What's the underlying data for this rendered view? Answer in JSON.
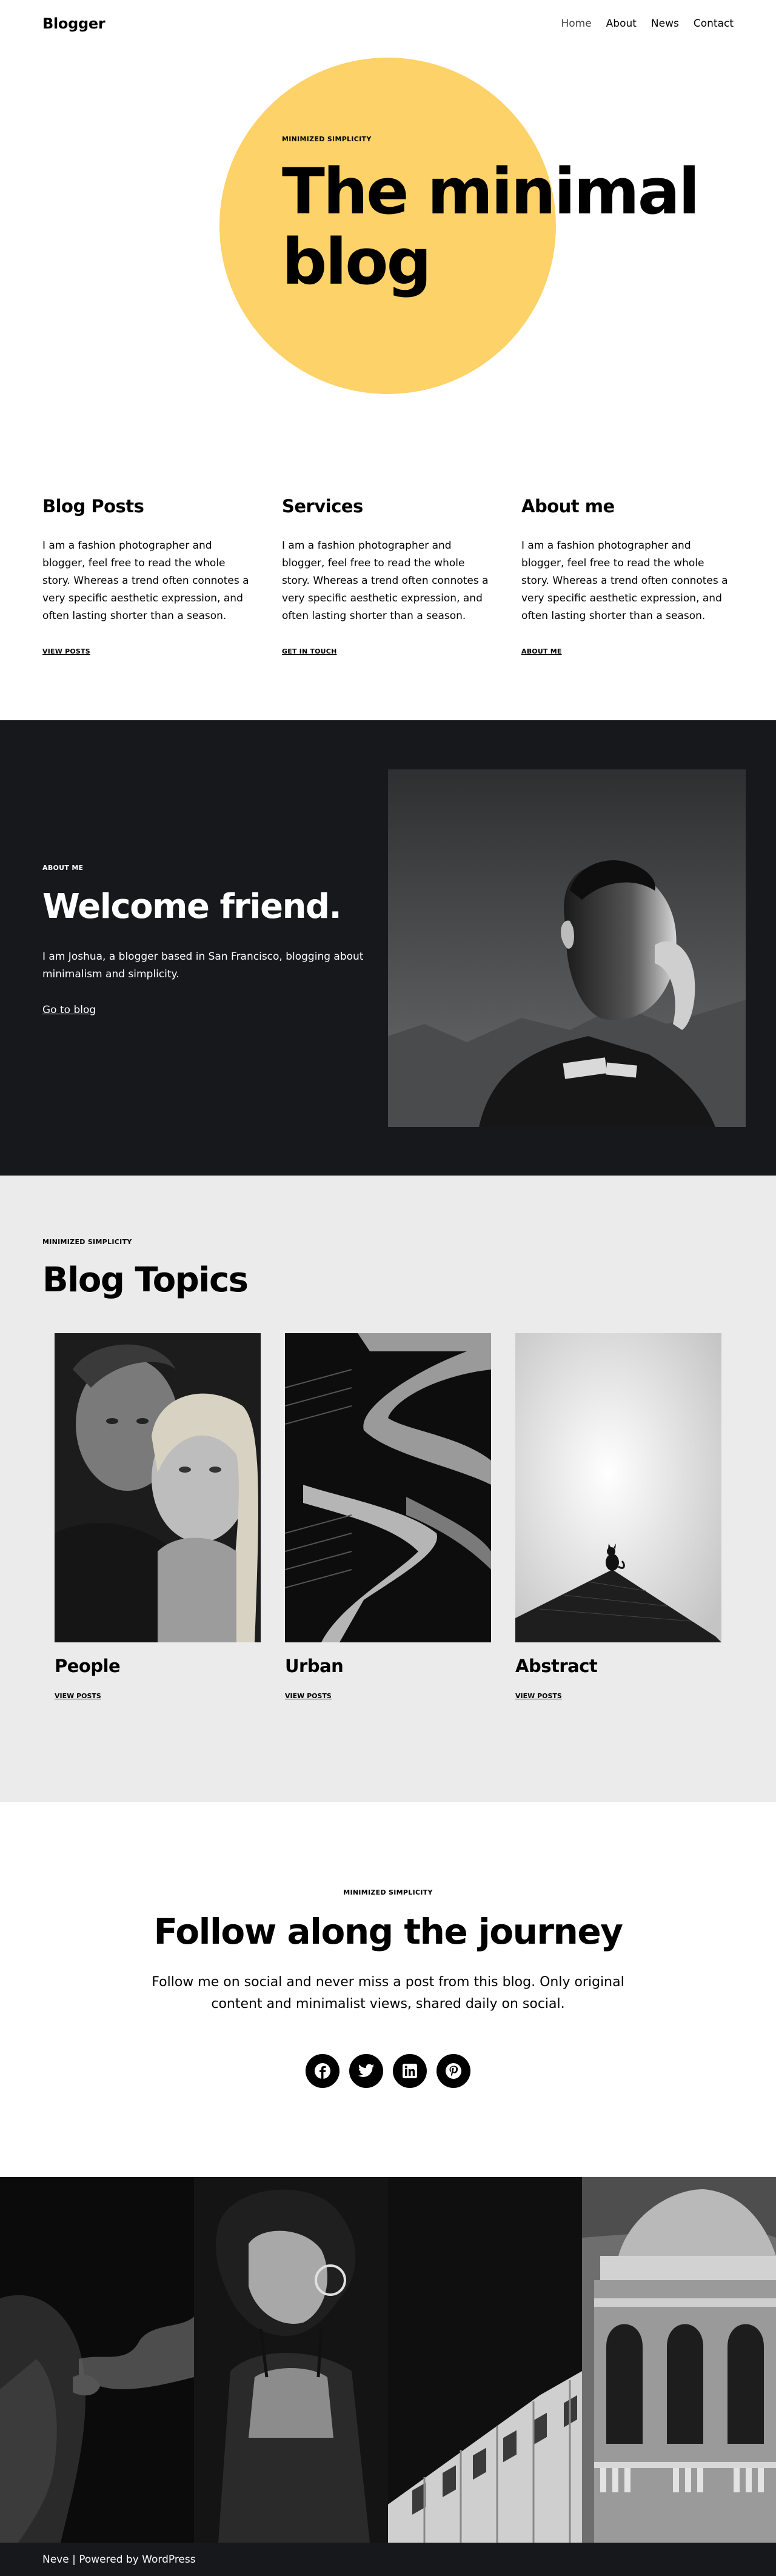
{
  "header": {
    "logo": "Blogger",
    "nav": [
      "Home",
      "About",
      "News",
      "Contact"
    ]
  },
  "hero": {
    "kicker": "MINIMIZED SIMPLICITY",
    "title_line1": "The minimal",
    "title_line2": "blog",
    "accent_color": "#fdd268"
  },
  "features": [
    {
      "title": "Blog Posts",
      "text": "I am a fashion photographer and blogger, feel free to read the whole story. Whereas a trend often connotes a very specific aesthetic expression, and often lasting shorter than a season.",
      "link": "VIEW POSTS"
    },
    {
      "title": "Services",
      "text": "I am a fashion photographer and blogger, feel free to read the whole story. Whereas a trend often connotes a very specific aesthetic expression, and often lasting shorter than a season.",
      "link": "GET IN TOUCH"
    },
    {
      "title": "About me",
      "text": "I am a fashion photographer and blogger, feel free to read the whole story. Whereas a trend often connotes a very specific aesthetic expression, and often lasting shorter than a season.",
      "link": "ABOUT ME"
    }
  ],
  "welcome": {
    "kicker": "ABOUT ME",
    "title": "Welcome friend.",
    "text": "I am Joshua, a blogger based in San Francisco, blogging about minimalism and simplicity.",
    "link": "Go to blog",
    "background": "#16181c"
  },
  "topics": {
    "kicker": "MINIMIZED SIMPLICITY",
    "title": "Blog Topics",
    "items": [
      {
        "title": "People",
        "link": "VIEW POSTS"
      },
      {
        "title": "Urban",
        "link": "VIEW POSTS"
      },
      {
        "title": "Abstract",
        "link": "VIEW POSTS"
      }
    ],
    "background": "#ebebeb"
  },
  "follow": {
    "kicker": "MINIMIZED SIMPLICITY",
    "title": "Follow along the journey",
    "text": "Follow me on social and never miss a post from this blog. Only original content and minimalist views, shared daily on social.",
    "socials": [
      "facebook-icon",
      "twitter-icon",
      "linkedin-icon",
      "pinterest-icon"
    ]
  },
  "footer": {
    "text": "Neve | Powered by WordPress"
  }
}
